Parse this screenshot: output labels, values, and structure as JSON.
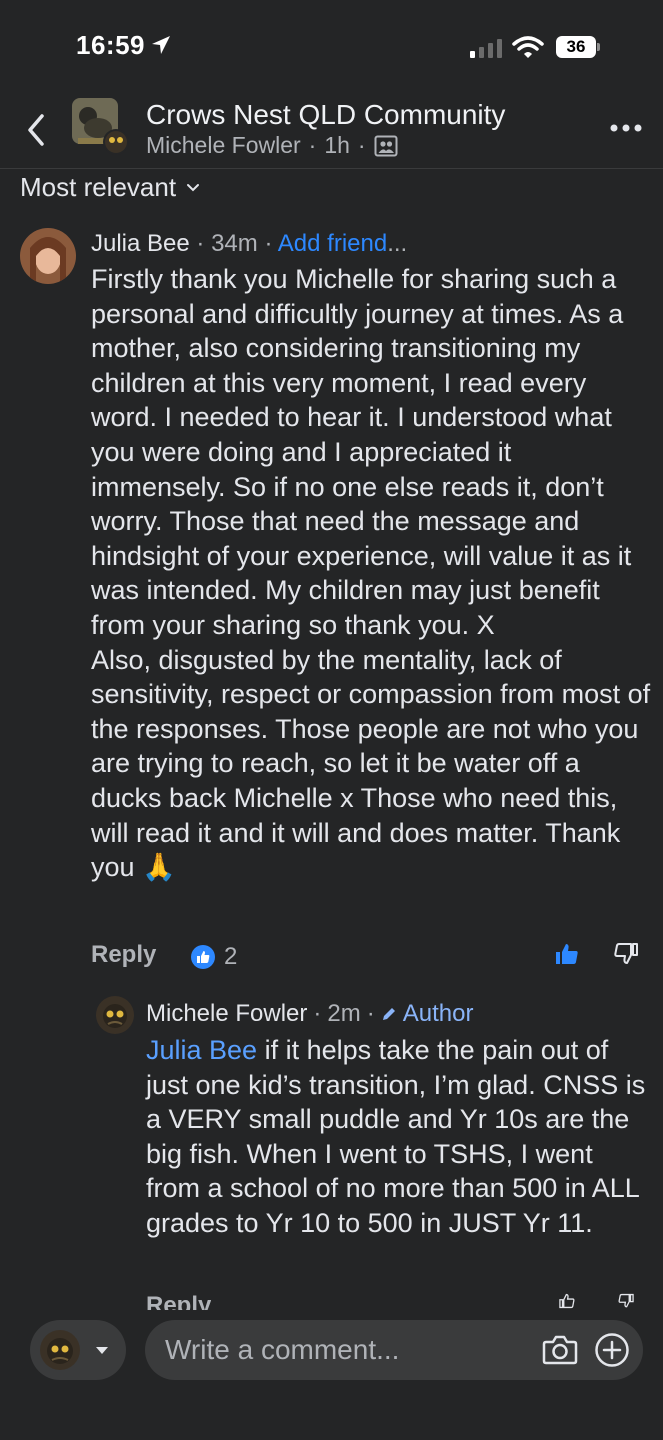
{
  "status_bar": {
    "time": "16:59",
    "battery": "36"
  },
  "header": {
    "group_name": "Crows Nest QLD Community",
    "author": "Michele Fowler",
    "time": "1h",
    "separator": "·"
  },
  "sort": {
    "label": "Most relevant"
  },
  "comment": {
    "author": "Julia Bee",
    "time": "34m",
    "add_friend": "Add friend",
    "more": "...",
    "paragraph1": "Firstly thank you Michelle for sharing such a personal and difficultly journey at times. As a mother, also considering transitioning my children at this very moment, I read every word. I needed to hear it. I understood what you were doing and I appreciated it immensely. So if no one else reads it, don’t worry. Those that need the message and hindsight of your experience, will value it as it was intended. My children may just benefit from your sharing so thank you. X",
    "paragraph2": "Also, disgusted by the mentality, lack of sensitivity, respect or compassion from most of the responses. Those people are not who you are trying to reach, so let it be water off a ducks back Michelle x Those who need this, will read it and it will and does matter. Thank you",
    "emoji": "🙏",
    "reply_label": "Reply",
    "reaction_count": "2"
  },
  "reply": {
    "author": "Michele Fowler",
    "time": "2m",
    "badge": "Author",
    "mention": "Julia Bee",
    "text": " if it helps take the pain out of just one kid’s transition, I’m glad. CNSS is a VERY small puddle and Yr 10s are the big fish. When I went to TSHS, I went from a school of no more than 500 in ALL grades to Yr 10 to 500 in JUST Yr 11.",
    "reply_label": "Reply"
  },
  "composer": {
    "placeholder": "Write a comment..."
  },
  "colors": {
    "background": "#242526",
    "accent": "#2d88ff",
    "text": "#e4e6eb",
    "muted": "#b0b3b8"
  }
}
